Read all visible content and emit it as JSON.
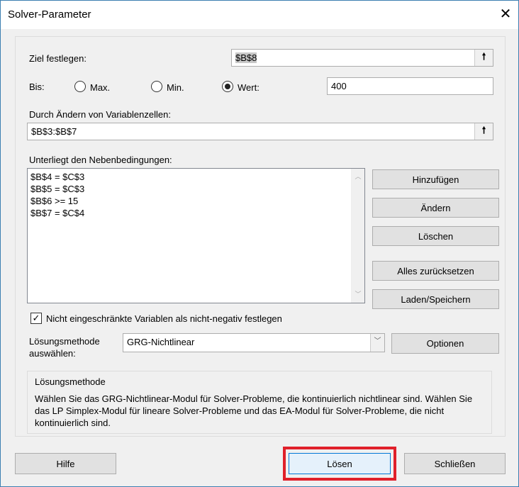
{
  "window": {
    "title": "Solver-Parameter",
    "close_icon": "close-icon"
  },
  "objective": {
    "label": "Ziel festlegen:",
    "value": "$B$8"
  },
  "to": {
    "label": "Bis:",
    "max": "Max.",
    "min": "Min.",
    "value_option": "Wert:",
    "selected": "Wert",
    "value": "400"
  },
  "variables": {
    "label": "Durch Ändern von Variablenzellen:",
    "value": "$B$3:$B$7"
  },
  "constraints": {
    "label": "Unterliegt den Nebenbedingungen:",
    "items": [
      "$B$4 = $C$3",
      "$B$5 = $C$3",
      "$B$6 >= 15",
      "$B$7 = $C$4"
    ]
  },
  "buttons": {
    "add": "Hinzufügen",
    "change": "Ändern",
    "delete": "Löschen",
    "reset": "Alles zurücksetzen",
    "load_save": "Laden/Speichern",
    "options": "Optionen",
    "help": "Hilfe",
    "solve": "Lösen",
    "close": "Schließen"
  },
  "nonneg": {
    "label": "Nicht eingeschränkte Variablen als nicht-negativ festlegen",
    "checked": true
  },
  "method": {
    "label_line1": "Lösungsmethode",
    "label_line2": "auswählen:",
    "selected": "GRG-Nichtlinear"
  },
  "description": {
    "title": "Lösungsmethode",
    "text": "Wählen Sie das GRG-Nichtlinear-Modul für Solver-Probleme, die kontinuierlich nichtlinear sind. Wählen Sie das LP Simplex-Modul für lineare Solver-Probleme und das EA-Modul für Solver-Probleme, die nicht kontinuierlich sind."
  },
  "highlight_color": "#e0202a"
}
